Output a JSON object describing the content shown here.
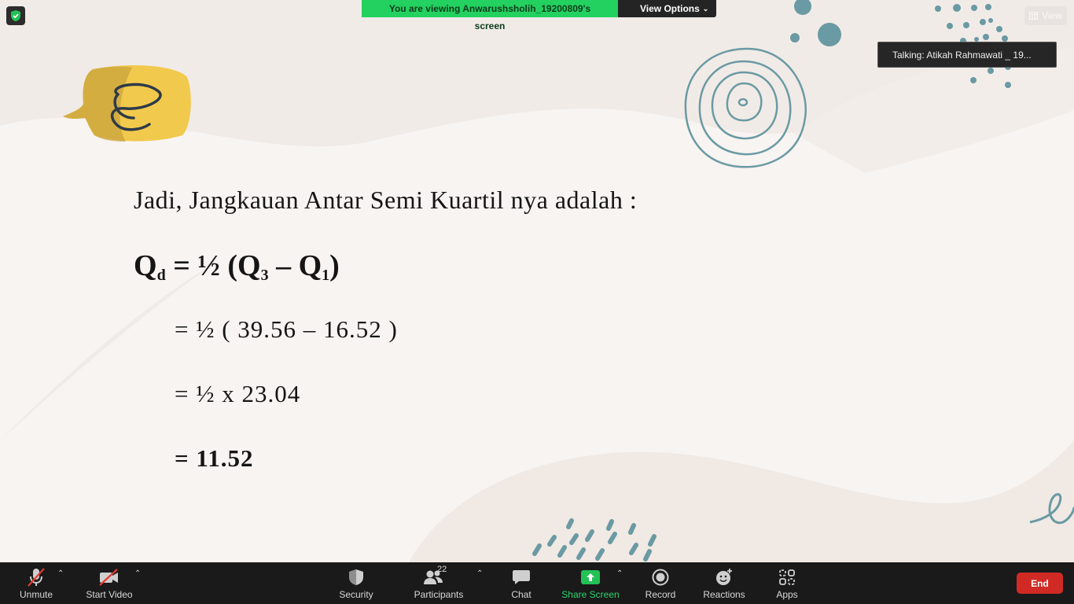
{
  "meeting": {
    "banner_text": "You are viewing Anwarushsholih_19200809's screen",
    "view_options_label": "View Options",
    "view_button_label": "View",
    "talking_text": "Talking: Atikah Rahmawati _ 19..."
  },
  "slide": {
    "heading": "Jadi, Jangkauan Antar Semi Kuartil nya adalah :",
    "formula_q": "Q",
    "formula_q_sub": "d",
    "formula_mid": " = ½ (Q",
    "formula_q3_sub": "3",
    "formula_minus": " – Q",
    "formula_q1_sub": "1",
    "formula_end": ")",
    "step1": "= ½ ( 39.56 – 16.52 )",
    "step2": "= ½ x 23.04",
    "step3": "= 11.52"
  },
  "toolbar": {
    "unmute_label": "Unmute",
    "start_video_label": "Start Video",
    "security_label": "Security",
    "participants_label": "Participants",
    "participants_count": "22",
    "chat_label": "Chat",
    "share_screen_label": "Share Screen",
    "record_label": "Record",
    "reactions_label": "Reactions",
    "apps_label": "Apps",
    "end_label": "End"
  },
  "colors": {
    "banner_green": "#23d160",
    "end_red": "#d12a24",
    "accent_teal": "#6a9aa3",
    "accent_yellow": "#f2c94c",
    "share_green": "#2bd46b"
  },
  "icons": [
    "shield-check-icon",
    "grid-icon",
    "microphone-muted-icon",
    "video-muted-icon",
    "security-shield-icon",
    "participants-icon",
    "chat-bubble-icon",
    "share-screen-icon",
    "record-icon",
    "reactions-icon",
    "apps-icon",
    "chevron-up-icon"
  ]
}
